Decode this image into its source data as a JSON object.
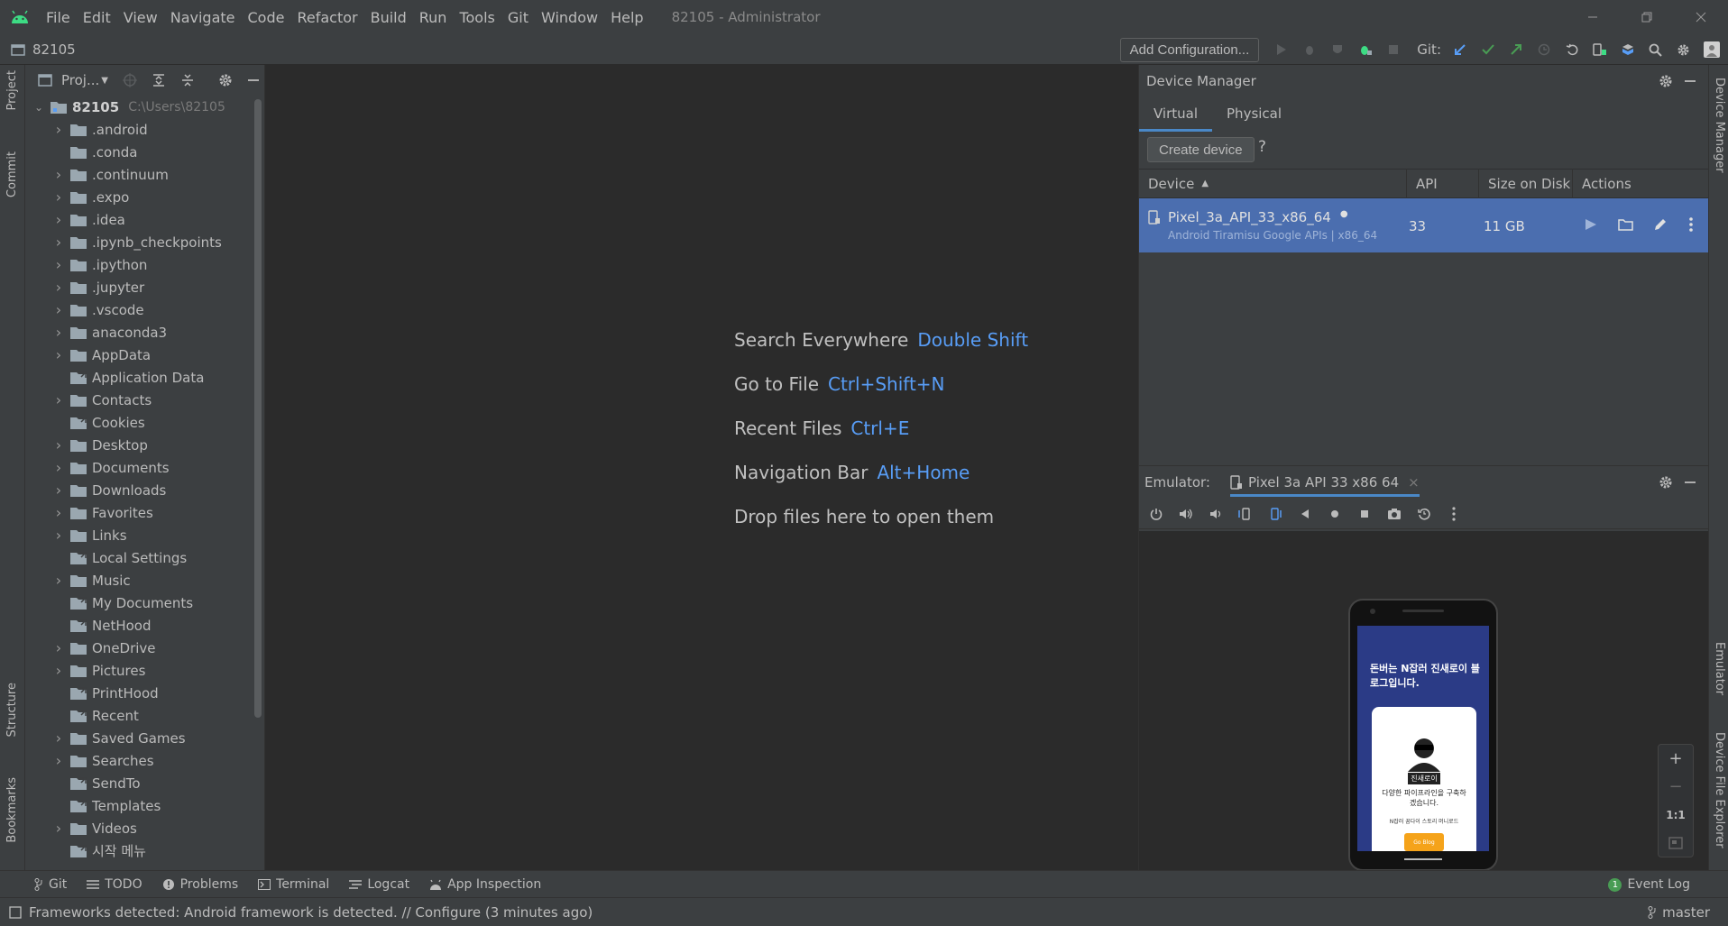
{
  "menu": [
    "File",
    "Edit",
    "View",
    "Navigate",
    "Code",
    "Refactor",
    "Build",
    "Run",
    "Tools",
    "Git",
    "Window",
    "Help"
  ],
  "window_title": "82105 - Administrator",
  "breadcrumb": "82105",
  "toolbar": {
    "add_configuration": "Add Configuration...",
    "git_label": "Git:"
  },
  "left_stripe": {
    "project": "Project",
    "commit": "Commit",
    "structure": "Structure",
    "bookmarks": "Bookmarks"
  },
  "right_stripe": {
    "device_manager": "Device Manager",
    "emulator": "Emulator",
    "device_file_explorer": "Device File Explorer"
  },
  "project": {
    "title": "Proj...",
    "root_name": "82105",
    "root_path": "C:\\Users\\82105",
    "items": [
      {
        "label": ".android",
        "expandable": true,
        "kind": "folder"
      },
      {
        "label": ".conda",
        "expandable": false,
        "kind": "folder"
      },
      {
        "label": ".continuum",
        "expandable": true,
        "kind": "folder"
      },
      {
        "label": ".expo",
        "expandable": true,
        "kind": "folder"
      },
      {
        "label": ".idea",
        "expandable": true,
        "kind": "folder"
      },
      {
        "label": ".ipynb_checkpoints",
        "expandable": true,
        "kind": "folder"
      },
      {
        "label": ".ipython",
        "expandable": true,
        "kind": "folder"
      },
      {
        "label": ".jupyter",
        "expandable": true,
        "kind": "folder"
      },
      {
        "label": ".vscode",
        "expandable": true,
        "kind": "folder"
      },
      {
        "label": "anaconda3",
        "expandable": true,
        "kind": "folder"
      },
      {
        "label": "AppData",
        "expandable": true,
        "kind": "folder"
      },
      {
        "label": "Application Data",
        "expandable": false,
        "kind": "link"
      },
      {
        "label": "Contacts",
        "expandable": true,
        "kind": "folder"
      },
      {
        "label": "Cookies",
        "expandable": false,
        "kind": "link"
      },
      {
        "label": "Desktop",
        "expandable": true,
        "kind": "folder"
      },
      {
        "label": "Documents",
        "expandable": true,
        "kind": "folder"
      },
      {
        "label": "Downloads",
        "expandable": true,
        "kind": "folder"
      },
      {
        "label": "Favorites",
        "expandable": true,
        "kind": "folder"
      },
      {
        "label": "Links",
        "expandable": true,
        "kind": "folder"
      },
      {
        "label": "Local Settings",
        "expandable": false,
        "kind": "link"
      },
      {
        "label": "Music",
        "expandable": true,
        "kind": "folder"
      },
      {
        "label": "My Documents",
        "expandable": false,
        "kind": "link"
      },
      {
        "label": "NetHood",
        "expandable": false,
        "kind": "link"
      },
      {
        "label": "OneDrive",
        "expandable": true,
        "kind": "folder"
      },
      {
        "label": "Pictures",
        "expandable": true,
        "kind": "folder"
      },
      {
        "label": "PrintHood",
        "expandable": false,
        "kind": "link"
      },
      {
        "label": "Recent",
        "expandable": false,
        "kind": "link"
      },
      {
        "label": "Saved Games",
        "expandable": true,
        "kind": "folder"
      },
      {
        "label": "Searches",
        "expandable": true,
        "kind": "folder"
      },
      {
        "label": "SendTo",
        "expandable": false,
        "kind": "link"
      },
      {
        "label": "Templates",
        "expandable": false,
        "kind": "link"
      },
      {
        "label": "Videos",
        "expandable": true,
        "kind": "folder"
      },
      {
        "label": "시작 메뉴",
        "expandable": false,
        "kind": "link"
      }
    ]
  },
  "editor_hints": [
    {
      "text": "Search Everywhere",
      "key": "Double Shift"
    },
    {
      "text": "Go to File",
      "key": "Ctrl+Shift+N"
    },
    {
      "text": "Recent Files",
      "key": "Ctrl+E"
    },
    {
      "text": "Navigation Bar",
      "key": "Alt+Home"
    },
    {
      "text": "Drop files here to open them",
      "key": ""
    }
  ],
  "device_manager": {
    "title": "Device Manager",
    "tabs": [
      "Virtual",
      "Physical"
    ],
    "create_device": "Create device",
    "help": "?",
    "columns": {
      "device": "Device",
      "api": "API",
      "size": "Size on Disk",
      "actions": "Actions"
    },
    "device": {
      "name": "Pixel_3a_API_33_x86_64",
      "subtitle": "Android Tiramisu Google APIs | x86_64",
      "api": "33",
      "size": "11 GB"
    }
  },
  "emulator": {
    "label": "Emulator:",
    "tab": "Pixel 3a API 33 x86 64",
    "zoom": {
      "plus": "+",
      "minus": "−",
      "one_to_one": "1:1"
    },
    "app": {
      "headline": "돈버는 N잡러 진새로이 블로그입니다.",
      "card_name": "진새로이",
      "card_desc": "다양한 파이프라인을 구축하겠습니다.",
      "card_tag": "N잡러 꿈다이 스토리 머니로드",
      "card_button": "Go Blog"
    }
  },
  "bottom_tools": [
    "Git",
    "TODO",
    "Problems",
    "Terminal",
    "Logcat",
    "App Inspection"
  ],
  "event_log": {
    "label": "Event Log",
    "count": "1"
  },
  "status": {
    "message": "Frameworks detected: Android framework is detected. // Configure (3 minutes ago)",
    "branch": "master"
  },
  "colors": {
    "accent": "#4a88c7",
    "selection": "#4b6eaf",
    "link": "#589df6",
    "android": "#3ddc84"
  }
}
